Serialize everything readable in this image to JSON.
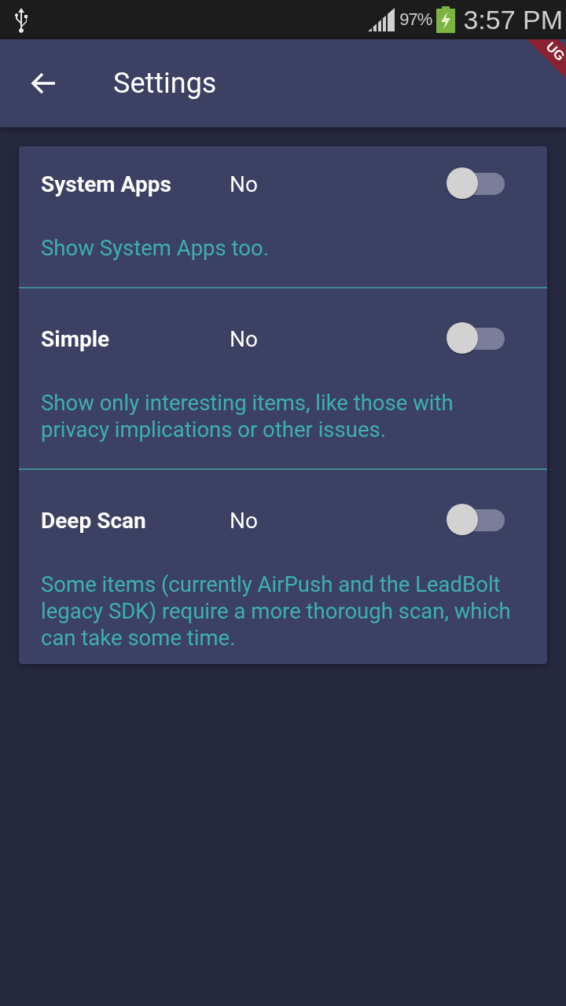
{
  "status_bar": {
    "battery": "97%",
    "time": "3:57 PM"
  },
  "debug_banner": "UG",
  "app_bar": {
    "title": "Settings"
  },
  "settings": [
    {
      "title": "System Apps",
      "value": "No",
      "on": false,
      "description": "Show System Apps too."
    },
    {
      "title": "Simple",
      "value": "No",
      "on": false,
      "description": "Show only interesting items, like those with privacy implications or other issues."
    },
    {
      "title": "Deep Scan",
      "value": "No",
      "on": false,
      "description": "Some items (currently AirPush and the LeadBolt legacy SDK) require a more thorough scan, which can take some time."
    }
  ]
}
